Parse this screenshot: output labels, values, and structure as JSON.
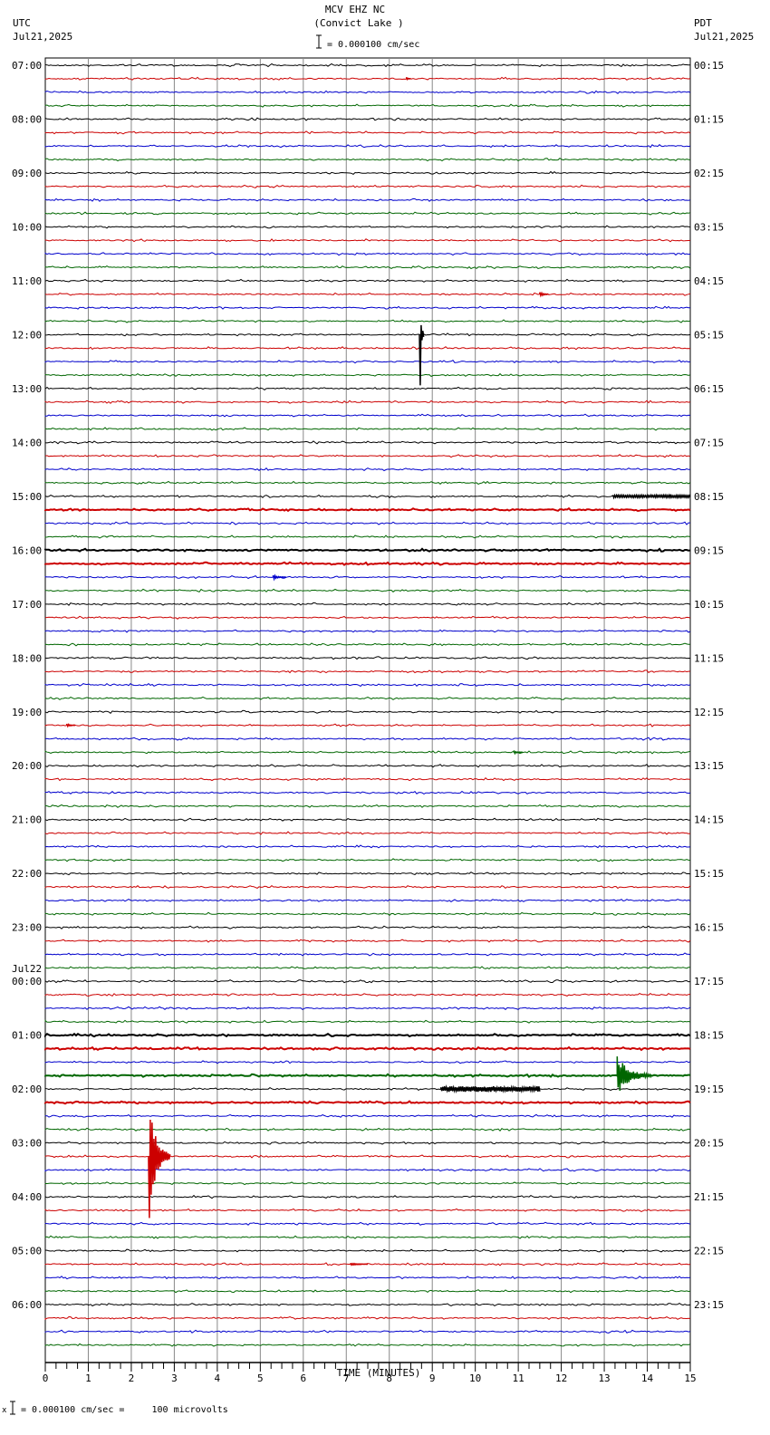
{
  "header": {
    "station": "MCV EHZ NC",
    "location": "(Convict Lake )",
    "scale": "= 0.000100 cm/sec",
    "left_tz": "UTC",
    "left_date": "Jul21,2025",
    "right_tz": "PDT",
    "right_date": "Jul21,2025"
  },
  "footer": {
    "scale_note": "= 0.000100 cm/sec =     100 microvolts",
    "marker": "x"
  },
  "chart_data": {
    "type": "line",
    "title": "MCV EHZ NC (Convict Lake )",
    "xlabel": "TIME (MINUTES)",
    "xlim": [
      0,
      15
    ],
    "x_ticks": [
      "0",
      "1",
      "2",
      "3",
      "4",
      "5",
      "6",
      "7",
      "8",
      "9",
      "10",
      "11",
      "12",
      "13",
      "14",
      "15"
    ],
    "trace_count": 96,
    "trace_colors": [
      "#000000",
      "#cc0000",
      "#0000cc",
      "#006600"
    ],
    "left_labels": [
      {
        "trace": 0,
        "text": "07:00"
      },
      {
        "trace": 4,
        "text": "08:00"
      },
      {
        "trace": 8,
        "text": "09:00"
      },
      {
        "trace": 12,
        "text": "10:00"
      },
      {
        "trace": 16,
        "text": "11:00"
      },
      {
        "trace": 20,
        "text": "12:00"
      },
      {
        "trace": 24,
        "text": "13:00"
      },
      {
        "trace": 28,
        "text": "14:00"
      },
      {
        "trace": 32,
        "text": "15:00"
      },
      {
        "trace": 36,
        "text": "16:00"
      },
      {
        "trace": 40,
        "text": "17:00"
      },
      {
        "trace": 44,
        "text": "18:00"
      },
      {
        "trace": 48,
        "text": "19:00"
      },
      {
        "trace": 52,
        "text": "20:00"
      },
      {
        "trace": 56,
        "text": "21:00"
      },
      {
        "trace": 60,
        "text": "22:00"
      },
      {
        "trace": 64,
        "text": "23:00"
      },
      {
        "trace": 68,
        "text": "00:00",
        "date": "Jul22"
      },
      {
        "trace": 72,
        "text": "01:00"
      },
      {
        "trace": 76,
        "text": "02:00"
      },
      {
        "trace": 80,
        "text": "03:00"
      },
      {
        "trace": 84,
        "text": "04:00"
      },
      {
        "trace": 88,
        "text": "05:00"
      },
      {
        "trace": 92,
        "text": "06:00"
      }
    ],
    "right_labels": [
      "00:15",
      "01:15",
      "02:15",
      "03:15",
      "04:15",
      "05:15",
      "06:15",
      "07:15",
      "08:15",
      "09:15",
      "10:15",
      "11:15",
      "12:15",
      "13:15",
      "14:15",
      "15:15",
      "16:15",
      "17:15",
      "18:15",
      "19:15",
      "20:15",
      "21:15",
      "22:15",
      "23:15"
    ],
    "thick_traces": [
      33,
      36,
      37,
      72,
      73,
      75,
      77
    ],
    "events": [
      {
        "trace": 1,
        "minute": 8.4,
        "amp": 4,
        "dur": 0.1
      },
      {
        "trace": 17,
        "minute": 11.5,
        "amp": 7,
        "dur": 0.2
      },
      {
        "trace": 20,
        "minute": 8.7,
        "amp": 56,
        "dur": 0.1,
        "dir": "down"
      },
      {
        "trace": 32,
        "minute": 13.2,
        "amp": 3,
        "dur": 1.8
      },
      {
        "trace": 38,
        "minute": 5.3,
        "amp": 5,
        "dur": 0.3
      },
      {
        "trace": 49,
        "minute": 0.5,
        "amp": 4,
        "dur": 0.2
      },
      {
        "trace": 51,
        "minute": 10.9,
        "amp": 4,
        "dur": 0.2
      },
      {
        "trace": 75,
        "minute": 13.3,
        "amp": 45,
        "dur": 0.8
      },
      {
        "trace": 76,
        "minute": 9.2,
        "amp": 6,
        "dur": 2.3
      },
      {
        "trace": 81,
        "minute": 2.4,
        "amp": 68,
        "dur": 0.5,
        "dir": "down"
      },
      {
        "trace": 89,
        "minute": 7.1,
        "amp": 3,
        "dur": 0.4
      }
    ]
  }
}
